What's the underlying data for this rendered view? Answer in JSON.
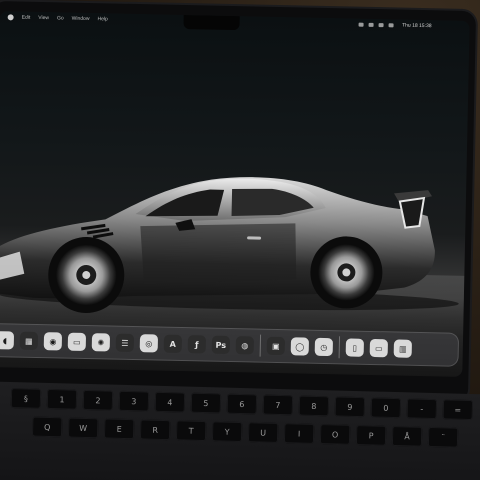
{
  "menubar": {
    "items": [
      "Edit",
      "View",
      "Go",
      "Window",
      "Help"
    ],
    "clock": "Thu 18 15:38"
  },
  "dock": {
    "apps": [
      {
        "icon": "finder-icon",
        "glyph": "◖",
        "dark": false
      },
      {
        "icon": "launchpad-icon",
        "glyph": "▦",
        "dark": true
      },
      {
        "icon": "safari-icon",
        "glyph": "◉",
        "dark": false
      },
      {
        "icon": "mail-icon",
        "glyph": "▭",
        "dark": false
      },
      {
        "icon": "settings-icon",
        "glyph": "✺",
        "dark": false
      },
      {
        "icon": "notes-icon",
        "glyph": "☰",
        "dark": true
      },
      {
        "icon": "music-icon",
        "glyph": "◎",
        "dark": false
      },
      {
        "icon": "appstore-icon",
        "glyph": "A",
        "dark": true
      },
      {
        "icon": "figma-icon",
        "glyph": "ƒ",
        "dark": true
      },
      {
        "icon": "photoshop-icon",
        "glyph": "Ps",
        "dark": true
      },
      {
        "icon": "chrome-icon",
        "glyph": "◍",
        "dark": true
      }
    ],
    "recent": [
      {
        "icon": "preview-icon",
        "glyph": "▣",
        "dark": true
      },
      {
        "icon": "messages-icon",
        "glyph": "◯",
        "dark": false
      },
      {
        "icon": "clock-icon",
        "glyph": "◷",
        "dark": false
      }
    ],
    "folders": [
      {
        "icon": "document-icon",
        "glyph": "▯",
        "dark": false
      },
      {
        "icon": "folder-icon",
        "glyph": "▭",
        "dark": false
      },
      {
        "icon": "trash-icon",
        "glyph": "▥",
        "dark": false
      }
    ]
  },
  "keyboard": {
    "row1": [
      "§",
      "1",
      "2",
      "3",
      "4",
      "5",
      "6",
      "7",
      "8",
      "9",
      "0",
      "-",
      "="
    ],
    "row2": [
      "Q",
      "W",
      "E",
      "R",
      "T",
      "Y",
      "U",
      "I",
      "O",
      "P",
      "Å",
      "¨"
    ]
  }
}
